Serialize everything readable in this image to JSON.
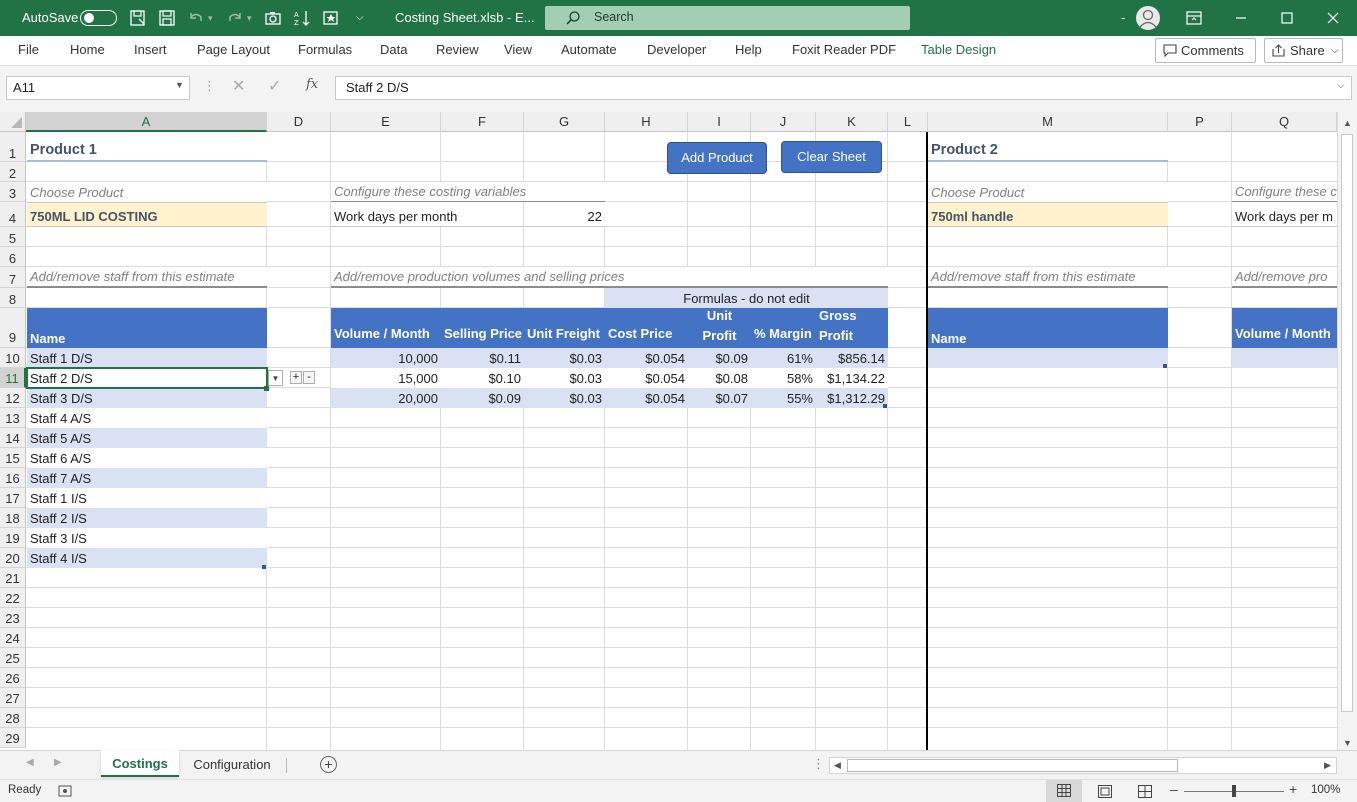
{
  "titlebar": {
    "autosave_label": "AutoSave",
    "autosave_state": "Off",
    "doc_title": "Costing Sheet.xlsb - E...",
    "search_placeholder": "Search",
    "bg_color": "#217346"
  },
  "ribbon_tabs": [
    "File",
    "Home",
    "Insert",
    "Page Layout",
    "Formulas",
    "Data",
    "Review",
    "View",
    "Automate",
    "Developer",
    "Help",
    "Foxit Reader PDF",
    "Table Design"
  ],
  "ribbon_active_contextual": "Table Design",
  "ribbon_buttons": {
    "comments": "Comments",
    "share": "Share"
  },
  "formula_bar": {
    "name_box": "A11",
    "formula": "Staff 2 D/S",
    "fx_label": "fx"
  },
  "columns": [
    "A",
    "D",
    "E",
    "F",
    "G",
    "H",
    "I",
    "J",
    "K",
    "L",
    "M",
    "P",
    "Q"
  ],
  "rows": [
    "1",
    "2",
    "3",
    "4",
    "5",
    "6",
    "7",
    "8",
    "9",
    "10",
    "11",
    "12",
    "13",
    "14",
    "15",
    "16",
    "17",
    "18",
    "19",
    "20",
    "21",
    "22",
    "23",
    "24",
    "25",
    "26",
    "27",
    "28",
    "29"
  ],
  "sheet": {
    "product1_title": "Product 1",
    "choose_product_label": "Choose Product",
    "product1_value": "750ML LID COSTING",
    "configure_label": "Configure these costing variables",
    "work_days_label": "Work days per month",
    "work_days_value": "22",
    "staff_hint": "Add/remove staff from this estimate",
    "production_hint": "Add/remove production volumes and selling prices",
    "formulas_banner": "Formulas - do not edit",
    "name_header": "Name",
    "staff": [
      "Staff 1 D/S",
      "Staff 2 D/S",
      "Staff 3 D/S",
      "Staff 4 A/S",
      "Staff 5 A/S",
      "Staff 6 A/S",
      "Staff 7 A/S",
      "Staff 1 I/S",
      "Staff 2 I/S",
      "Staff 3 I/S",
      "Staff 4 I/S"
    ],
    "prod_headers": [
      "Volume / Month",
      "Selling Price",
      "Unit Freight",
      "Cost Price",
      "Unit Profit",
      "% Margin",
      "Gross Profit"
    ],
    "prod_rows": [
      [
        "10,000",
        "$0.11",
        "$0.03",
        "$0.054",
        "$0.09",
        "61%",
        "$856.14"
      ],
      [
        "15,000",
        "$0.10",
        "$0.03",
        "$0.054",
        "$0.08",
        "58%",
        "$1,134.22"
      ],
      [
        "20,000",
        "$0.09",
        "$0.03",
        "$0.054",
        "$0.07",
        "55%",
        "$1,312.29"
      ]
    ],
    "add_product_button": "Add Product",
    "clear_sheet_button": "Clear Sheet",
    "product2_title": "Product 2",
    "product2_choose_label": "Choose Product",
    "product2_value": "750ml handle",
    "product2_configure_label": "Configure these c",
    "product2_work_days_label": "Work days per m",
    "product2_staff_hint": "Add/remove staff from this estimate",
    "product2_production_hint": "Add/remove pro",
    "product2_name_header": "Name",
    "product2_volume_header": "Volume / Month"
  },
  "sheet_tabs": [
    {
      "label": "Costings",
      "active": true
    },
    {
      "label": "Configuration",
      "active": false
    }
  ],
  "status": {
    "ready": "Ready",
    "zoom": "100%"
  },
  "colors": {
    "table_header": "#4472c4",
    "band": "#d9e1f2",
    "product_fill": "#fff2cc",
    "title_text": "#44546a"
  }
}
